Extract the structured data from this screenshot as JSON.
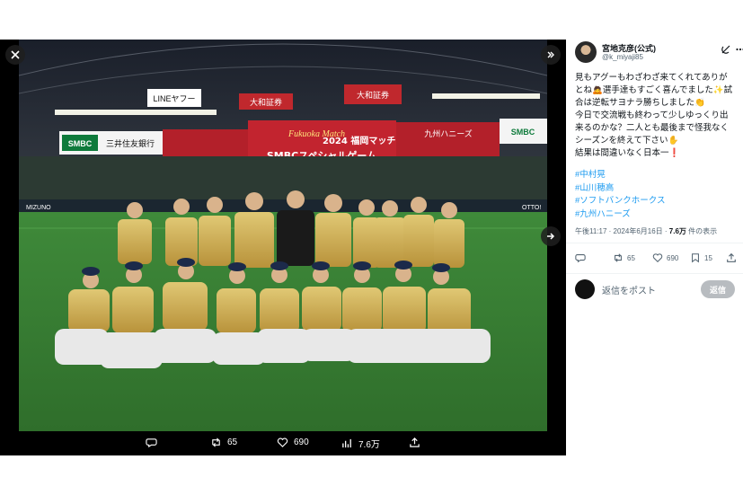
{
  "post": {
    "author_name": "宮地克彦(公式)",
    "author_handle": "@k_miyaji85",
    "body_lines": [
      "見もアグーもわざわざ来てくれてありが",
      "とね🙇選手達もすごく喜んでました✨試",
      "合は逆転サヨナラ勝ちしました👏",
      "今日で交流戦も終わって少しゆっくり出",
      "来るのかな？二人とも最後まで怪我なく",
      "シーズンを終えて下さい✋",
      "結果は間違いなく日本一❗️"
    ],
    "hashtags": [
      "#中村晃",
      "#山川穂高",
      "#ソフトバンクホークス",
      "#九州ハニーズ"
    ],
    "time": "午後11:17 · 2024年6月16日 · ",
    "views_count": "7.6万",
    "views_label": " 件の表示"
  },
  "panel_actions": {
    "reposts": "65",
    "likes": "690",
    "bookmarks": "15"
  },
  "reply": {
    "placeholder": "返信をポスト",
    "button": "返信"
  },
  "viewer_actions": {
    "reposts": "65",
    "likes": "690",
    "views": "7.6万"
  },
  "photo": {
    "board_title": "Fukuoka Match",
    "board_sub": "2024 福岡マッチ",
    "board_main": "SMBCスペシャルゲーム",
    "ad_bank": "三井住友銀行",
    "ad_smbc": "SMBC",
    "ad_line": "LINEヤフー",
    "ad_daiwa": "大和証券",
    "ad_honeys": "九州ハニーズ",
    "ad_mizuno": "MIZUNO",
    "ad_otto": "OTTO!"
  },
  "colors": {
    "accent": "#1d9bf0",
    "muted": "#536471",
    "uniform_gold": "#c9a84c",
    "turf": "#3f8a3a"
  },
  "icons": [
    "close-icon",
    "expand-icon",
    "next-arrow-icon",
    "reply-icon",
    "repost-icon",
    "like-icon",
    "views-icon",
    "share-icon",
    "bookmark-icon",
    "grok-icon",
    "more-icon"
  ]
}
